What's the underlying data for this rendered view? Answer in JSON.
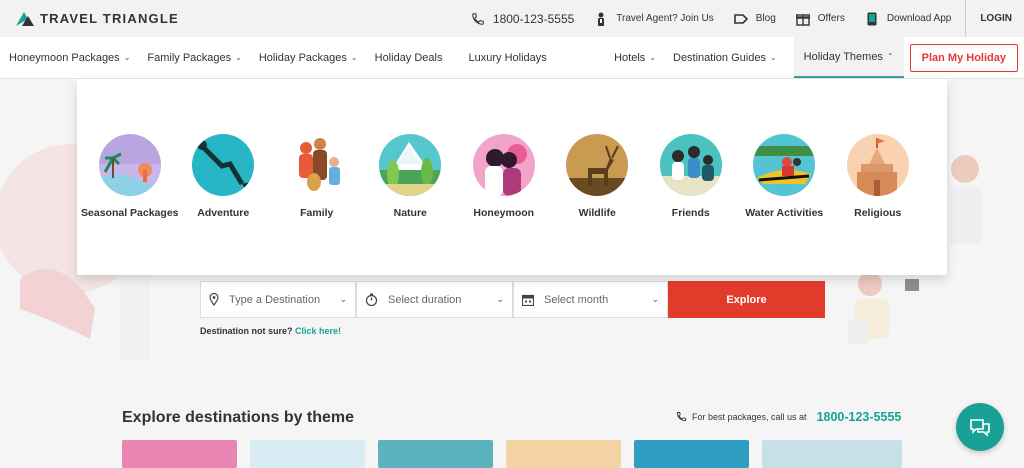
{
  "brand": {
    "name": "TRAVEL TRIANGLE"
  },
  "topbar": {
    "phone": "1800-123-5555",
    "items": [
      {
        "label": "Travel Agent? Join Us",
        "icon": "person-icon"
      },
      {
        "label": "Blog",
        "icon": "blog-icon"
      },
      {
        "label": "Offers",
        "icon": "gift-icon"
      },
      {
        "label": "Download App",
        "icon": "phone-app-icon"
      }
    ],
    "login": "LOGIN"
  },
  "nav": {
    "left": [
      {
        "label": "Honeymoon Packages",
        "dropdown": true
      },
      {
        "label": "Family Packages",
        "dropdown": true
      },
      {
        "label": "Holiday Packages",
        "dropdown": true
      },
      {
        "label": "Holiday Deals",
        "dropdown": false
      },
      {
        "label": "Luxury Holidays",
        "dropdown": false
      }
    ],
    "right": [
      {
        "label": "Hotels",
        "dropdown": true
      },
      {
        "label": "Destination Guides",
        "dropdown": true
      },
      {
        "label": "Holiday Themes",
        "dropdown": true,
        "active": true
      }
    ],
    "cta": "Plan My Holiday"
  },
  "themes": [
    {
      "label": "Seasonal Packages"
    },
    {
      "label": "Adventure"
    },
    {
      "label": "Family"
    },
    {
      "label": "Nature"
    },
    {
      "label": "Honeymoon"
    },
    {
      "label": "Wildlife"
    },
    {
      "label": "Friends"
    },
    {
      "label": "Water Activities"
    },
    {
      "label": "Religious"
    }
  ],
  "search": {
    "destination_placeholder": "Type a Destination",
    "duration_placeholder": "Select duration",
    "month_placeholder": "Select month",
    "button": "Explore"
  },
  "dest_note": {
    "text": "Destination not sure?",
    "link": "Click here!"
  },
  "explore": {
    "title": "Explore destinations by theme",
    "call_text": "For best packages, call us at",
    "call_number": "1800-123-5555"
  },
  "colors": {
    "accent": "#1aa197",
    "cta": "#e23b2b"
  }
}
